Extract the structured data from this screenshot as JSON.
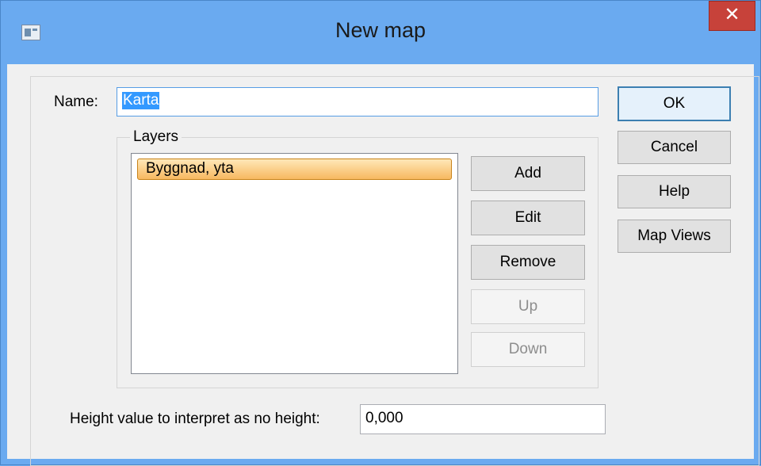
{
  "window": {
    "title": "New map",
    "close_glyph": "✕"
  },
  "form": {
    "name_label": "Name:",
    "name_value": "Karta",
    "layers_label": "Layers",
    "layers": [
      {
        "label": "Byggnad, yta",
        "selected": true
      }
    ],
    "height_label": "Height value to interpret as no height:",
    "height_value": "0,000"
  },
  "layer_buttons": {
    "add": "Add",
    "edit": "Edit",
    "remove": "Remove",
    "up": "Up",
    "down": "Down"
  },
  "dialog_buttons": {
    "ok": "OK",
    "cancel": "Cancel",
    "help": "Help",
    "map_views": "Map Views"
  },
  "colors": {
    "titlebar": "#6aaaf0",
    "close_button": "#c7423a",
    "selection": "#3399ff",
    "list_item_highlight": "#f7b860"
  }
}
